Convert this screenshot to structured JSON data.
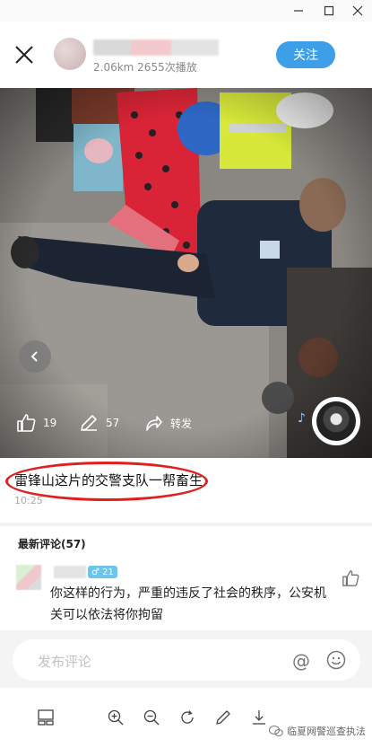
{
  "window": {
    "minimize_icon": "minimize-icon",
    "maximize_icon": "maximize-icon",
    "close_icon": "close-icon"
  },
  "header": {
    "stats": "2.06km  2655次播放",
    "follow_label": "关注",
    "accent_color": "#3d9fe8"
  },
  "actions": {
    "likes": "19",
    "comments": "57",
    "share_label": "转发"
  },
  "post": {
    "caption": "雷锋山这片的交警支队一帮畜生",
    "time": "10:25",
    "highlight_color": "#e02020"
  },
  "comments": {
    "title": "最新评论(57)",
    "items": [
      {
        "badge": "♂ 21",
        "text": "你这样的行为，严重的违反了社会的秩序，公安机关可以依法将你拘留"
      }
    ]
  },
  "input": {
    "placeholder": "发布评论",
    "at_symbol": "@"
  },
  "watermark": {
    "text": "临夏网警巡查执法"
  }
}
